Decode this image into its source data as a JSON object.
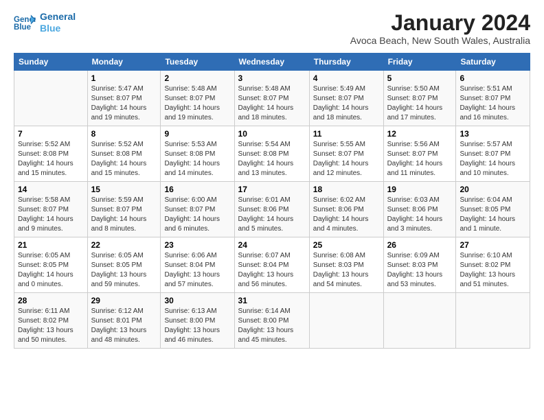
{
  "header": {
    "logo_line1": "General",
    "logo_line2": "Blue",
    "title": "January 2024",
    "subtitle": "Avoca Beach, New South Wales, Australia"
  },
  "calendar": {
    "days_of_week": [
      "Sunday",
      "Monday",
      "Tuesday",
      "Wednesday",
      "Thursday",
      "Friday",
      "Saturday"
    ],
    "weeks": [
      [
        {
          "num": "",
          "info": ""
        },
        {
          "num": "1",
          "info": "Sunrise: 5:47 AM\nSunset: 8:07 PM\nDaylight: 14 hours\nand 19 minutes."
        },
        {
          "num": "2",
          "info": "Sunrise: 5:48 AM\nSunset: 8:07 PM\nDaylight: 14 hours\nand 19 minutes."
        },
        {
          "num": "3",
          "info": "Sunrise: 5:48 AM\nSunset: 8:07 PM\nDaylight: 14 hours\nand 18 minutes."
        },
        {
          "num": "4",
          "info": "Sunrise: 5:49 AM\nSunset: 8:07 PM\nDaylight: 14 hours\nand 18 minutes."
        },
        {
          "num": "5",
          "info": "Sunrise: 5:50 AM\nSunset: 8:07 PM\nDaylight: 14 hours\nand 17 minutes."
        },
        {
          "num": "6",
          "info": "Sunrise: 5:51 AM\nSunset: 8:07 PM\nDaylight: 14 hours\nand 16 minutes."
        }
      ],
      [
        {
          "num": "7",
          "info": "Sunrise: 5:52 AM\nSunset: 8:08 PM\nDaylight: 14 hours\nand 15 minutes."
        },
        {
          "num": "8",
          "info": "Sunrise: 5:52 AM\nSunset: 8:08 PM\nDaylight: 14 hours\nand 15 minutes."
        },
        {
          "num": "9",
          "info": "Sunrise: 5:53 AM\nSunset: 8:08 PM\nDaylight: 14 hours\nand 14 minutes."
        },
        {
          "num": "10",
          "info": "Sunrise: 5:54 AM\nSunset: 8:08 PM\nDaylight: 14 hours\nand 13 minutes."
        },
        {
          "num": "11",
          "info": "Sunrise: 5:55 AM\nSunset: 8:07 PM\nDaylight: 14 hours\nand 12 minutes."
        },
        {
          "num": "12",
          "info": "Sunrise: 5:56 AM\nSunset: 8:07 PM\nDaylight: 14 hours\nand 11 minutes."
        },
        {
          "num": "13",
          "info": "Sunrise: 5:57 AM\nSunset: 8:07 PM\nDaylight: 14 hours\nand 10 minutes."
        }
      ],
      [
        {
          "num": "14",
          "info": "Sunrise: 5:58 AM\nSunset: 8:07 PM\nDaylight: 14 hours\nand 9 minutes."
        },
        {
          "num": "15",
          "info": "Sunrise: 5:59 AM\nSunset: 8:07 PM\nDaylight: 14 hours\nand 8 minutes."
        },
        {
          "num": "16",
          "info": "Sunrise: 6:00 AM\nSunset: 8:07 PM\nDaylight: 14 hours\nand 6 minutes."
        },
        {
          "num": "17",
          "info": "Sunrise: 6:01 AM\nSunset: 8:06 PM\nDaylight: 14 hours\nand 5 minutes."
        },
        {
          "num": "18",
          "info": "Sunrise: 6:02 AM\nSunset: 8:06 PM\nDaylight: 14 hours\nand 4 minutes."
        },
        {
          "num": "19",
          "info": "Sunrise: 6:03 AM\nSunset: 8:06 PM\nDaylight: 14 hours\nand 3 minutes."
        },
        {
          "num": "20",
          "info": "Sunrise: 6:04 AM\nSunset: 8:05 PM\nDaylight: 14 hours\nand 1 minute."
        }
      ],
      [
        {
          "num": "21",
          "info": "Sunrise: 6:05 AM\nSunset: 8:05 PM\nDaylight: 14 hours\nand 0 minutes."
        },
        {
          "num": "22",
          "info": "Sunrise: 6:05 AM\nSunset: 8:05 PM\nDaylight: 13 hours\nand 59 minutes."
        },
        {
          "num": "23",
          "info": "Sunrise: 6:06 AM\nSunset: 8:04 PM\nDaylight: 13 hours\nand 57 minutes."
        },
        {
          "num": "24",
          "info": "Sunrise: 6:07 AM\nSunset: 8:04 PM\nDaylight: 13 hours\nand 56 minutes."
        },
        {
          "num": "25",
          "info": "Sunrise: 6:08 AM\nSunset: 8:03 PM\nDaylight: 13 hours\nand 54 minutes."
        },
        {
          "num": "26",
          "info": "Sunrise: 6:09 AM\nSunset: 8:03 PM\nDaylight: 13 hours\nand 53 minutes."
        },
        {
          "num": "27",
          "info": "Sunrise: 6:10 AM\nSunset: 8:02 PM\nDaylight: 13 hours\nand 51 minutes."
        }
      ],
      [
        {
          "num": "28",
          "info": "Sunrise: 6:11 AM\nSunset: 8:02 PM\nDaylight: 13 hours\nand 50 minutes."
        },
        {
          "num": "29",
          "info": "Sunrise: 6:12 AM\nSunset: 8:01 PM\nDaylight: 13 hours\nand 48 minutes."
        },
        {
          "num": "30",
          "info": "Sunrise: 6:13 AM\nSunset: 8:00 PM\nDaylight: 13 hours\nand 46 minutes."
        },
        {
          "num": "31",
          "info": "Sunrise: 6:14 AM\nSunset: 8:00 PM\nDaylight: 13 hours\nand 45 minutes."
        },
        {
          "num": "",
          "info": ""
        },
        {
          "num": "",
          "info": ""
        },
        {
          "num": "",
          "info": ""
        }
      ]
    ]
  }
}
